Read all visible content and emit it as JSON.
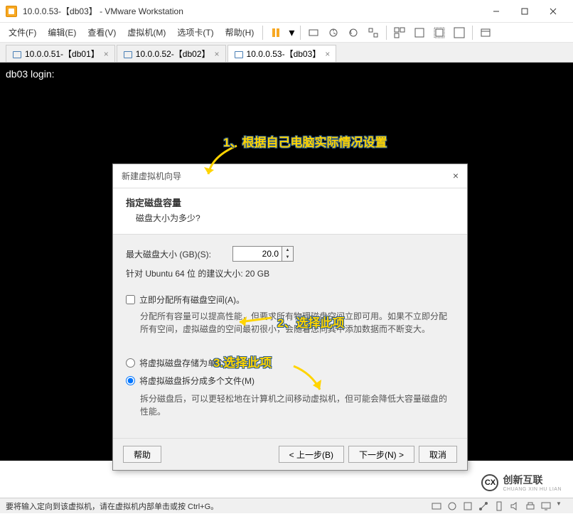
{
  "window": {
    "title": "10.0.0.53-【db03】  - VMware Workstation"
  },
  "menu": {
    "file": "文件(F)",
    "edit": "编辑(E)",
    "view": "查看(V)",
    "vm": "虚拟机(M)",
    "tabs": "选项卡(T)",
    "help": "帮助(H)"
  },
  "tabs": [
    {
      "label": "10.0.0.51-【db01】",
      "active": false
    },
    {
      "label": "10.0.0.52-【db02】",
      "active": false
    },
    {
      "label": "10.0.0.53-【db03】",
      "active": true
    }
  ],
  "terminal": {
    "line1": "db03 login:"
  },
  "dialog": {
    "title": "新建虚拟机向导",
    "header_title": "指定磁盘容量",
    "header_sub": "磁盘大小为多少?",
    "max_size_label": "最大磁盘大小 (GB)(S):",
    "max_size_value": "20.0",
    "recommended": "针对 Ubuntu 64 位 的建议大小: 20 GB",
    "alloc_now": "立即分配所有磁盘空间(A)。",
    "alloc_help": "分配所有容量可以提高性能，但要求所有物理磁盘空间立即可用。如果不立即分配所有空间，虚拟磁盘的空间最初很小，会随着您向其中添加数据而不断变大。",
    "single_file": "将虚拟磁盘存储为单个文件(O)",
    "multi_file": "将虚拟磁盘拆分成多个文件(M)",
    "multi_help": "拆分磁盘后，可以更轻松地在计算机之间移动虚拟机，但可能会降低大容量磁盘的性能。",
    "btn_help": "帮助",
    "btn_back": "< 上一步(B)",
    "btn_next": "下一步(N) >",
    "btn_cancel": "取消"
  },
  "annotations": {
    "a1": "1、根据自己电脑实际情况设置",
    "a2": "2、选择此项",
    "a3": "3.选择此项"
  },
  "statusbar": {
    "text": "要将输入定向到该虚拟机，请在虚拟机内部单击或按 Ctrl+G。"
  },
  "watermark": {
    "main": "创新互联",
    "sub": "CHUANG XIN HU LIAN"
  }
}
